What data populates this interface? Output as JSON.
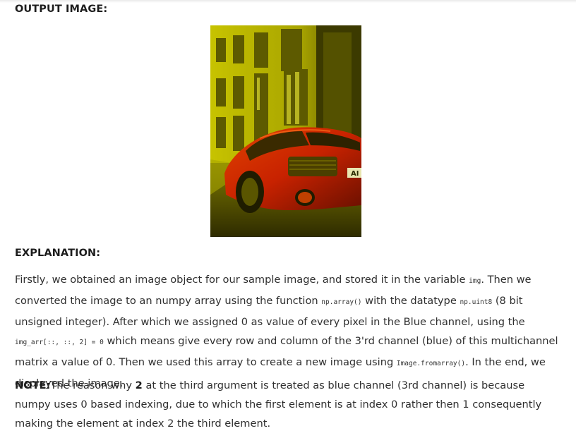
{
  "headings": {
    "output": "OUTPUT IMAGE:",
    "explanation": "EXPLANATION:"
  },
  "image": {
    "plate_text": "AI",
    "tint_color": "#c9c400"
  },
  "explanation": {
    "s1a": "Firstly, we obtained an image object for our sample image, and stored it in the variable ",
    "c1": "img",
    "s1b": ". Then we converted the image to an numpy array using the function ",
    "c2": "np.array()",
    "s1c": " with the datatype ",
    "c3": "np.uint8",
    "s1d": " (8 bit unsigned integer). After which we assigned 0 as value of every pixel in the Blue channel, using the ",
    "c4": "img_arr[::, ::, 2] = 0",
    "s1e": " which means give every row and column of the 3'rd channel (blue) of this multichannel matrix a value of 0. Then we used this array to create a new image using ",
    "c5": "Image.fromarray()",
    "s1f": ". In the end, we displayed the image."
  },
  "note": {
    "label": "NOTE:",
    "s2a": "The reason why ",
    "bold_num": "2",
    "s2b": " at the third argument is treated as blue channel (3rd channel) is because numpy uses 0 based indexing, due to which the first element is at index 0 rather then 1 consequently making the element at index 2 the third element."
  }
}
